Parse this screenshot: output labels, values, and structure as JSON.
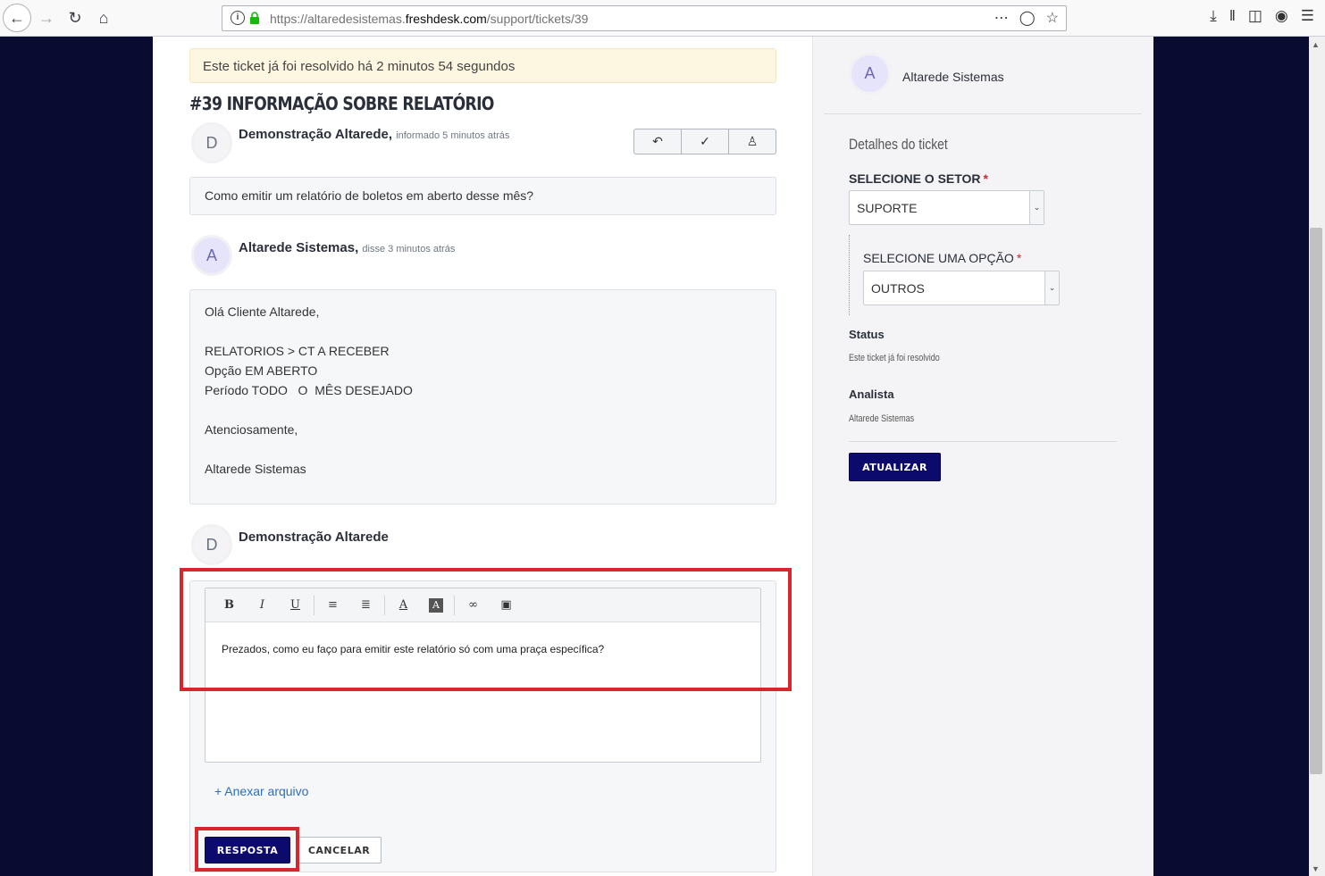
{
  "browser": {
    "url_prefix": "https://altaredesistemas.",
    "url_domain": "freshdesk.com",
    "url_path": "/support/tickets/39"
  },
  "banner": "Este ticket já foi resolvido há 2 minutos 54 segundos",
  "ticket_title": "#39 INFORMAÇÃO SOBRE RELATÓRIO",
  "messages": [
    {
      "avatar": "D",
      "author": "Demonstração Altarede,",
      "meta": "informado 5 minutos atrás",
      "body": "Como emitir um relatório de boletos em aberto desse mês?"
    },
    {
      "avatar": "A",
      "author": "Altarede Sistemas,",
      "meta": "disse 3 minutos atrás",
      "body_lines": [
        "Olá Cliente Altarede,",
        "",
        "RELATORIOS > CT A RECEBER",
        "Opção EM ABERTO",
        "Período TODO   O  MÊS DESEJADO",
        "",
        "Atenciosamente,",
        "",
        "Altarede Sistemas"
      ]
    }
  ],
  "reply": {
    "avatar": "D",
    "author": "Demonstração Altarede",
    "editor_text": "Prezados, como eu faço para emitir este relatório só com uma praça específica?",
    "attach_label": "+ Anexar arquivo",
    "submit_label": "RESPOSTA",
    "cancel_label": "CANCELAR",
    "toolbar": {
      "bold": "B",
      "italic": "I",
      "underline": "U",
      "font_color": "A",
      "bg_color": "A"
    }
  },
  "sidebar": {
    "avatar": "A",
    "name": "Altarede Sistemas",
    "details_title": "Detalhes do ticket",
    "setor_label": "SELECIONE O SETOR",
    "setor_value": "SUPORTE",
    "opcao_label": "SELECIONE UMA OPÇÃO",
    "opcao_value": "OUTROS",
    "required_mark": "*",
    "status_label": "Status",
    "status_value": "Este ticket já foi resolvido",
    "analista_label": "Analista",
    "analista_value": "Altarede Sistemas",
    "update_label": "ATUALIZAR"
  },
  "colors": {
    "primary": "#0d0a6e",
    "highlight": "#d9262c",
    "banner": "#fdf6e1",
    "link": "#2c6fbb"
  }
}
